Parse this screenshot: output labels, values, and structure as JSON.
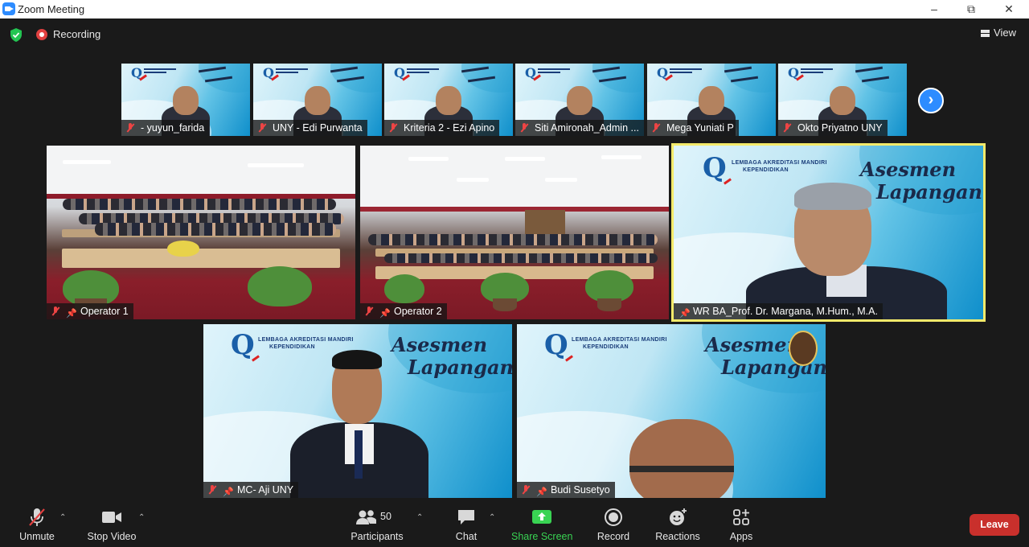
{
  "window": {
    "title": "Zoom Meeting",
    "minimize": "–",
    "restore": "⧉",
    "close": "✕"
  },
  "topbar": {
    "recording_label": "Recording",
    "view_label": "View"
  },
  "thumbnails": [
    {
      "name": "- yuyun_farida"
    },
    {
      "name": "UNY - Edi Purwanta"
    },
    {
      "name": "Kriteria 2 - Ezi Apino"
    },
    {
      "name": "Siti Amironah_Admin ..."
    },
    {
      "name": "Mega Yuniati P"
    },
    {
      "name": "Okto Priyatno UNY"
    }
  ],
  "main_tiles": [
    {
      "name": "Operator 1"
    },
    {
      "name": "Operator 2"
    },
    {
      "name": "WR BA_Prof. Dr. Margana, M.Hum., M.A."
    }
  ],
  "bottom_tiles": [
    {
      "name": "MC- Aji UNY"
    },
    {
      "name": "Budi Susetyo"
    }
  ],
  "background": {
    "logo_text_line1": "LEMBAGA AKREDITASI MANDIRI",
    "logo_text_line2": "KEPENDIDIKAN",
    "title_line1": "Asesmen",
    "title_line2": "Lapangan"
  },
  "toolbar": {
    "unmute": "Unmute",
    "stop_video": "Stop Video",
    "participants": "Participants",
    "participants_count": "50",
    "chat": "Chat",
    "share_screen": "Share Screen",
    "record": "Record",
    "reactions": "Reactions",
    "apps": "Apps",
    "leave": "Leave"
  },
  "colors": {
    "accent": "#2d8cff",
    "active_speaker_border": "#f4ea6a",
    "leave": "#c9302c",
    "share": "#39d353",
    "recording": "#e04040"
  },
  "icons": [
    "zoom-logo-icon",
    "shield-check-icon",
    "recording-icon",
    "grid-view-icon",
    "mic-off-icon",
    "pin-icon",
    "chevron-right-icon",
    "video-icon",
    "participants-icon",
    "chat-icon",
    "share-screen-icon",
    "record-icon",
    "reactions-icon",
    "apps-icon"
  ]
}
